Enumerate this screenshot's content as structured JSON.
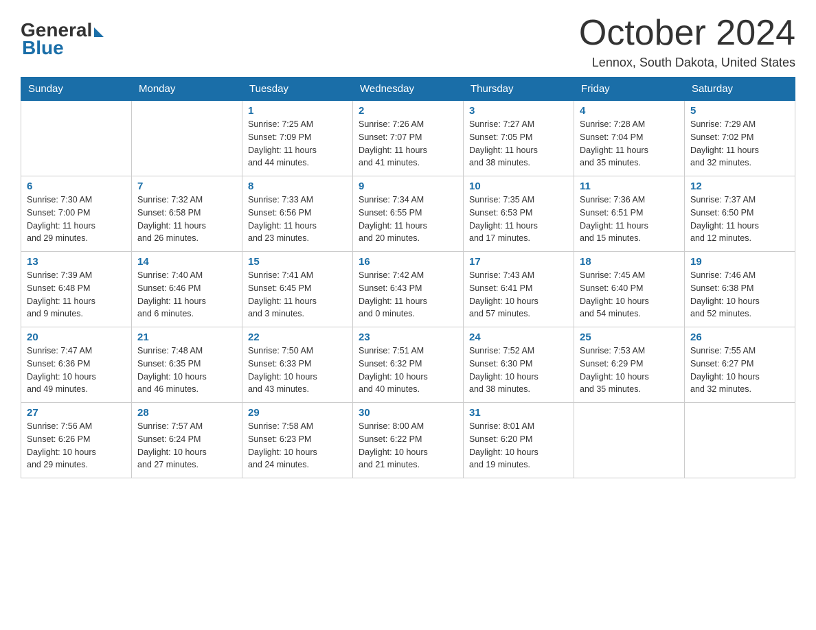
{
  "header": {
    "logo_general": "General",
    "logo_blue": "Blue",
    "month_title": "October 2024",
    "location": "Lennox, South Dakota, United States"
  },
  "days_of_week": [
    "Sunday",
    "Monday",
    "Tuesday",
    "Wednesday",
    "Thursday",
    "Friday",
    "Saturday"
  ],
  "weeks": [
    [
      {
        "day": "",
        "info": ""
      },
      {
        "day": "",
        "info": ""
      },
      {
        "day": "1",
        "info": "Sunrise: 7:25 AM\nSunset: 7:09 PM\nDaylight: 11 hours\nand 44 minutes."
      },
      {
        "day": "2",
        "info": "Sunrise: 7:26 AM\nSunset: 7:07 PM\nDaylight: 11 hours\nand 41 minutes."
      },
      {
        "day": "3",
        "info": "Sunrise: 7:27 AM\nSunset: 7:05 PM\nDaylight: 11 hours\nand 38 minutes."
      },
      {
        "day": "4",
        "info": "Sunrise: 7:28 AM\nSunset: 7:04 PM\nDaylight: 11 hours\nand 35 minutes."
      },
      {
        "day": "5",
        "info": "Sunrise: 7:29 AM\nSunset: 7:02 PM\nDaylight: 11 hours\nand 32 minutes."
      }
    ],
    [
      {
        "day": "6",
        "info": "Sunrise: 7:30 AM\nSunset: 7:00 PM\nDaylight: 11 hours\nand 29 minutes."
      },
      {
        "day": "7",
        "info": "Sunrise: 7:32 AM\nSunset: 6:58 PM\nDaylight: 11 hours\nand 26 minutes."
      },
      {
        "day": "8",
        "info": "Sunrise: 7:33 AM\nSunset: 6:56 PM\nDaylight: 11 hours\nand 23 minutes."
      },
      {
        "day": "9",
        "info": "Sunrise: 7:34 AM\nSunset: 6:55 PM\nDaylight: 11 hours\nand 20 minutes."
      },
      {
        "day": "10",
        "info": "Sunrise: 7:35 AM\nSunset: 6:53 PM\nDaylight: 11 hours\nand 17 minutes."
      },
      {
        "day": "11",
        "info": "Sunrise: 7:36 AM\nSunset: 6:51 PM\nDaylight: 11 hours\nand 15 minutes."
      },
      {
        "day": "12",
        "info": "Sunrise: 7:37 AM\nSunset: 6:50 PM\nDaylight: 11 hours\nand 12 minutes."
      }
    ],
    [
      {
        "day": "13",
        "info": "Sunrise: 7:39 AM\nSunset: 6:48 PM\nDaylight: 11 hours\nand 9 minutes."
      },
      {
        "day": "14",
        "info": "Sunrise: 7:40 AM\nSunset: 6:46 PM\nDaylight: 11 hours\nand 6 minutes."
      },
      {
        "day": "15",
        "info": "Sunrise: 7:41 AM\nSunset: 6:45 PM\nDaylight: 11 hours\nand 3 minutes."
      },
      {
        "day": "16",
        "info": "Sunrise: 7:42 AM\nSunset: 6:43 PM\nDaylight: 11 hours\nand 0 minutes."
      },
      {
        "day": "17",
        "info": "Sunrise: 7:43 AM\nSunset: 6:41 PM\nDaylight: 10 hours\nand 57 minutes."
      },
      {
        "day": "18",
        "info": "Sunrise: 7:45 AM\nSunset: 6:40 PM\nDaylight: 10 hours\nand 54 minutes."
      },
      {
        "day": "19",
        "info": "Sunrise: 7:46 AM\nSunset: 6:38 PM\nDaylight: 10 hours\nand 52 minutes."
      }
    ],
    [
      {
        "day": "20",
        "info": "Sunrise: 7:47 AM\nSunset: 6:36 PM\nDaylight: 10 hours\nand 49 minutes."
      },
      {
        "day": "21",
        "info": "Sunrise: 7:48 AM\nSunset: 6:35 PM\nDaylight: 10 hours\nand 46 minutes."
      },
      {
        "day": "22",
        "info": "Sunrise: 7:50 AM\nSunset: 6:33 PM\nDaylight: 10 hours\nand 43 minutes."
      },
      {
        "day": "23",
        "info": "Sunrise: 7:51 AM\nSunset: 6:32 PM\nDaylight: 10 hours\nand 40 minutes."
      },
      {
        "day": "24",
        "info": "Sunrise: 7:52 AM\nSunset: 6:30 PM\nDaylight: 10 hours\nand 38 minutes."
      },
      {
        "day": "25",
        "info": "Sunrise: 7:53 AM\nSunset: 6:29 PM\nDaylight: 10 hours\nand 35 minutes."
      },
      {
        "day": "26",
        "info": "Sunrise: 7:55 AM\nSunset: 6:27 PM\nDaylight: 10 hours\nand 32 minutes."
      }
    ],
    [
      {
        "day": "27",
        "info": "Sunrise: 7:56 AM\nSunset: 6:26 PM\nDaylight: 10 hours\nand 29 minutes."
      },
      {
        "day": "28",
        "info": "Sunrise: 7:57 AM\nSunset: 6:24 PM\nDaylight: 10 hours\nand 27 minutes."
      },
      {
        "day": "29",
        "info": "Sunrise: 7:58 AM\nSunset: 6:23 PM\nDaylight: 10 hours\nand 24 minutes."
      },
      {
        "day": "30",
        "info": "Sunrise: 8:00 AM\nSunset: 6:22 PM\nDaylight: 10 hours\nand 21 minutes."
      },
      {
        "day": "31",
        "info": "Sunrise: 8:01 AM\nSunset: 6:20 PM\nDaylight: 10 hours\nand 19 minutes."
      },
      {
        "day": "",
        "info": ""
      },
      {
        "day": "",
        "info": ""
      }
    ]
  ]
}
